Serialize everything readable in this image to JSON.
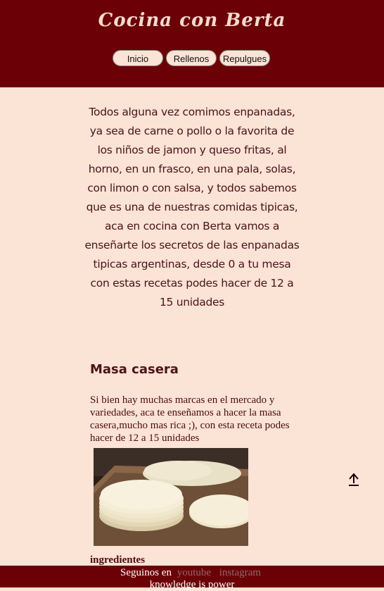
{
  "header": {
    "brand": "Cocina con Berta",
    "nav": [
      "Inicio",
      "Rellenos",
      "Repulgues"
    ]
  },
  "intro": {
    "text": "Todos alguna vez comimos enpanadas, ya sea de carne o pollo o la favorita de los niños de jamon y queso fritas, al horno, en un frasco, en una pala, solas, con limon o con salsa, y todos sabemos que es una de nuestras comidas tipicas, aca en cocina con Berta vamos a enseñarte los secretos de las enpanadas tipicas argentinas, desde 0 a tu mesa con estas recetas podes hacer de 12 a 15 unidades"
  },
  "section": {
    "title": "Masa casera",
    "text": "Si bien hay muchas marcas en el mercado y variedades, aca te enseñamos a hacer la masa casera,mucho mas rica ;), con esta receta podes hacer de 12 a 15 unidades",
    "ingredients_label": "ingredientes"
  },
  "footer": {
    "lead": "Seguinos en",
    "links": [
      "youtube",
      "instagram"
    ],
    "motto": "knowledge is power"
  },
  "icons": {
    "scroll_top": "arrow-up-icon"
  },
  "colors": {
    "header_bg": "#6b0006",
    "page_bg": "#fbe3d6",
    "text": "#4a1418"
  }
}
